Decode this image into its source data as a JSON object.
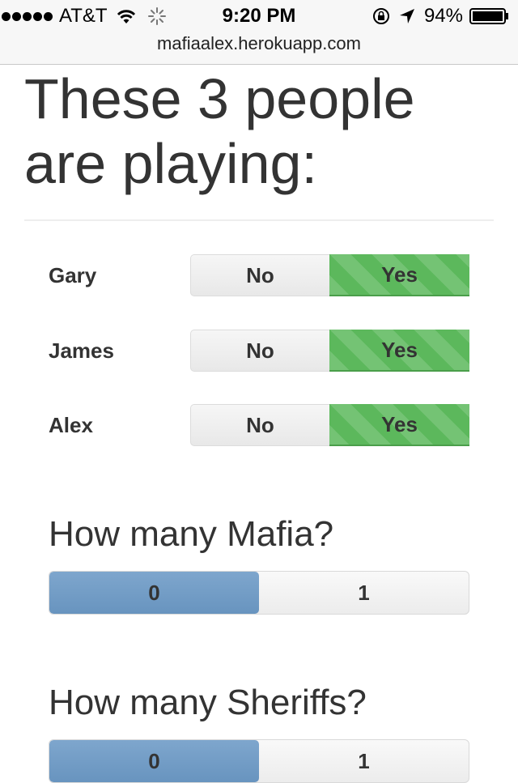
{
  "status_bar": {
    "carrier": "AT&T",
    "time": "9:20 PM",
    "battery_percent": "94%",
    "icons": [
      "signal-dots-icon",
      "wifi-icon",
      "loading-spinner-icon",
      "rotation-lock-icon",
      "location-arrow-icon",
      "battery-icon"
    ]
  },
  "browser": {
    "url": "mafiaalex.herokuapp.com"
  },
  "page": {
    "heading_line1": "These 3 people",
    "heading_line2": "are playing:"
  },
  "players": [
    {
      "name": "Gary",
      "no_label": "No",
      "yes_label": "Yes",
      "selected": "Yes"
    },
    {
      "name": "James",
      "no_label": "No",
      "yes_label": "Yes",
      "selected": "Yes"
    },
    {
      "name": "Alex",
      "no_label": "No",
      "yes_label": "Yes",
      "selected": "Yes"
    }
  ],
  "mafia": {
    "title": "How many Mafia?",
    "options": [
      "0",
      "1"
    ],
    "selected": "0"
  },
  "sheriffs": {
    "title": "How many Sheriffs?",
    "options": [
      "0",
      "1"
    ],
    "selected": "0"
  },
  "colors": {
    "yes_green": "#5cb85c",
    "selected_blue": "#6894bf",
    "text": "#333333"
  }
}
